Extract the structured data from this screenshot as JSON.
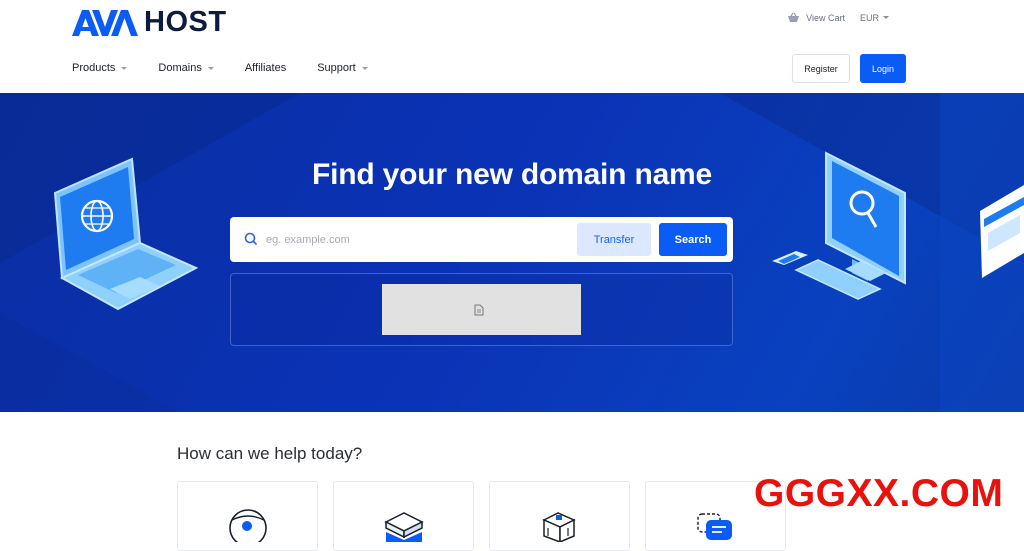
{
  "brand": {
    "logo_mark": "AVA",
    "logo_text": "HOST",
    "accent": "#0a5cf5",
    "dark": "#0d1b3e"
  },
  "topbar": {
    "cart_icon": "basket-icon",
    "cart_label": "View Cart",
    "currency_label": "EUR"
  },
  "nav": {
    "items": [
      {
        "label": "Products",
        "dropdown": true
      },
      {
        "label": "Domains",
        "dropdown": true
      },
      {
        "label": "Affiliates",
        "dropdown": false
      },
      {
        "label": "Support",
        "dropdown": true
      }
    ],
    "register_label": "Register",
    "login_label": "Login"
  },
  "hero": {
    "title": "Find your new domain name",
    "search": {
      "placeholder": "eg. example.com",
      "value": "",
      "icon": "search-icon"
    },
    "transfer_label": "Transfer",
    "search_label": "Search",
    "captcha_icon": "broken-image-icon"
  },
  "help": {
    "title": "How can we help today?",
    "cards": [
      {
        "icon": "globe-icon"
      },
      {
        "icon": "server-icon"
      },
      {
        "icon": "package-icon"
      },
      {
        "icon": "chat-icon"
      }
    ]
  },
  "watermark": {
    "text": "GGGXX.COM",
    "color": "#e8110b"
  }
}
